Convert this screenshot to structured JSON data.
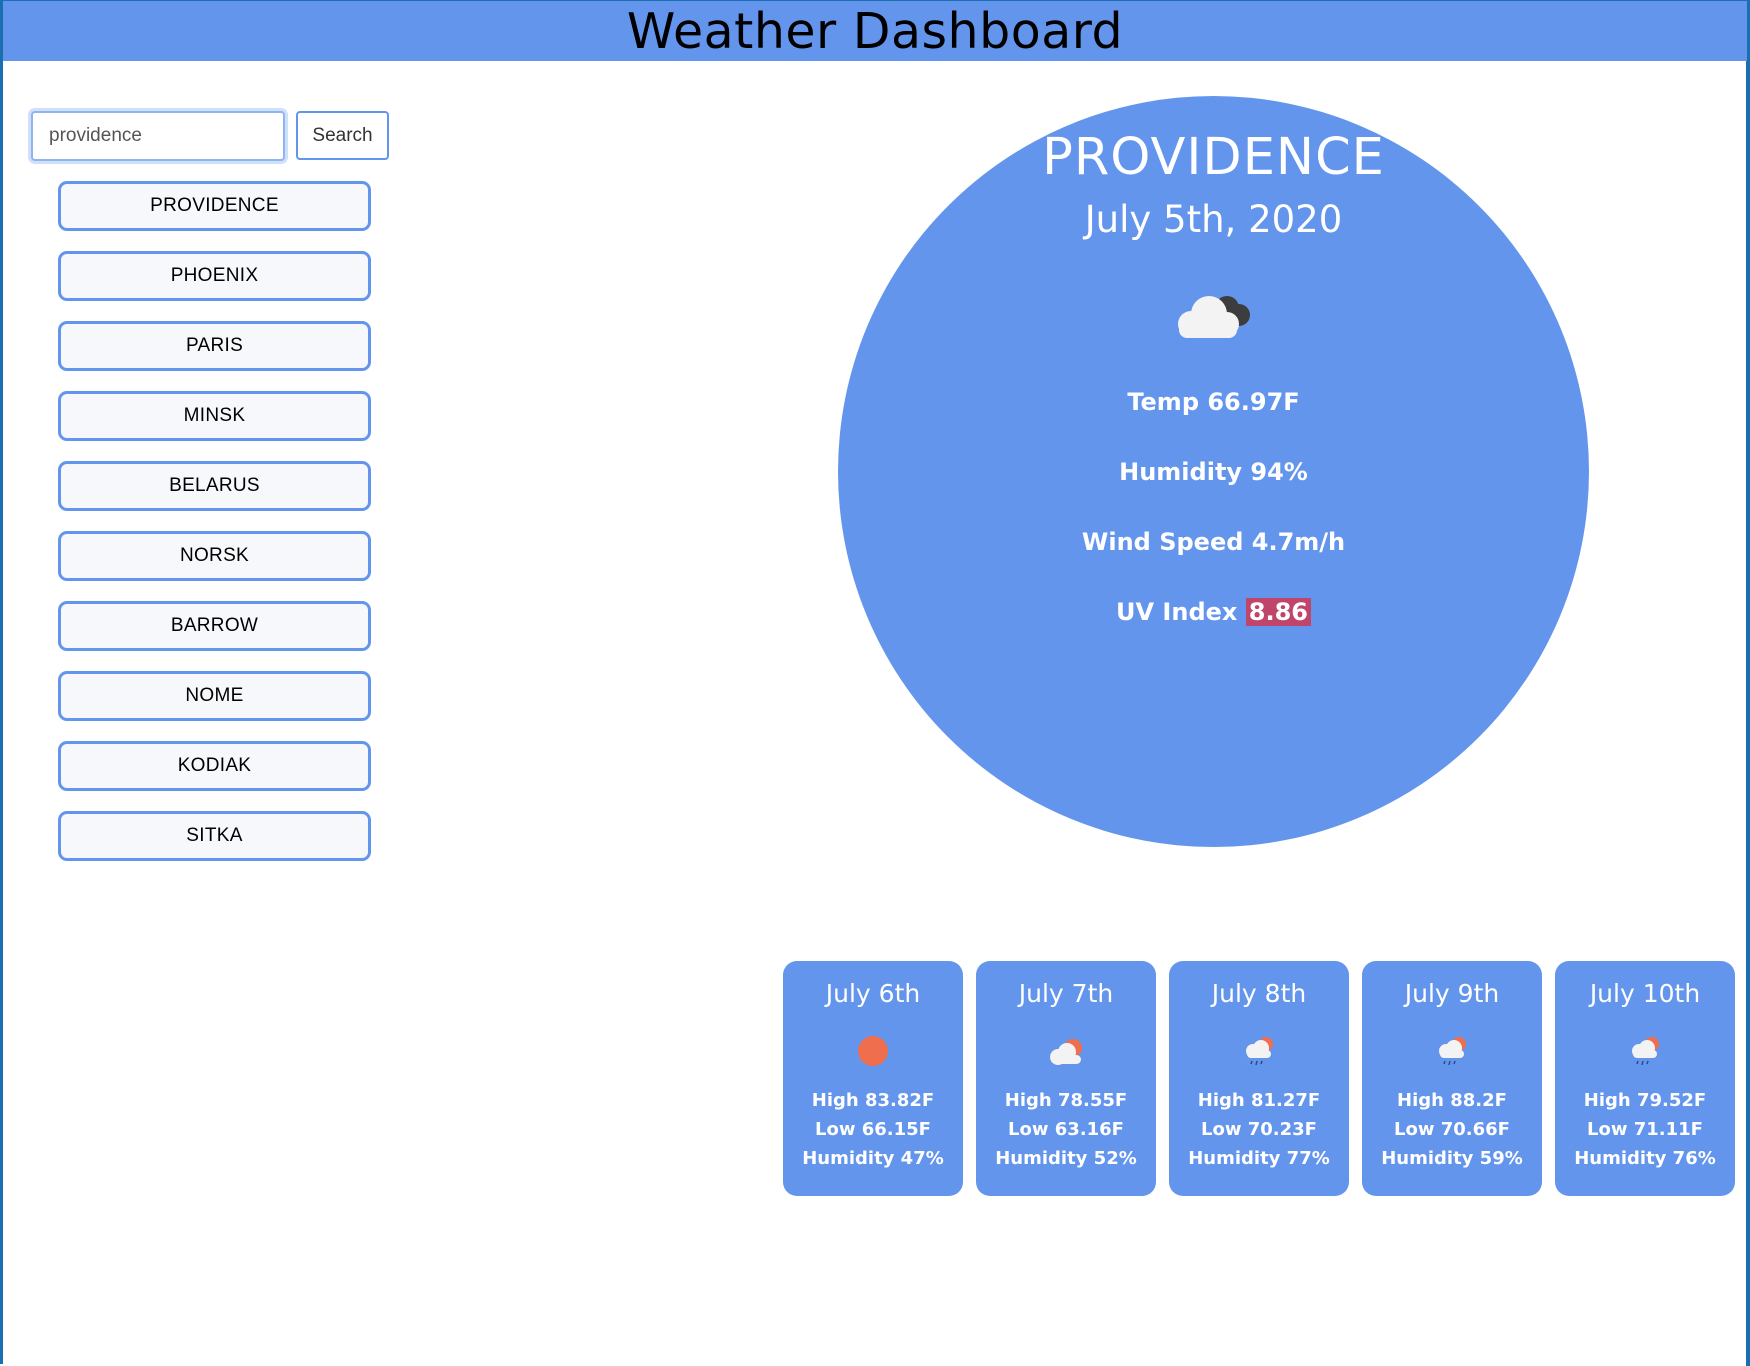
{
  "header": {
    "title": "Weather Dashboard"
  },
  "search": {
    "value": "providence",
    "button_label": "Search"
  },
  "cities": [
    "PROVIDENCE",
    "PHOENIX",
    "PARIS",
    "MINSK",
    "BELARUS",
    "NORSK",
    "BARROW",
    "NOME",
    "KODIAK",
    "SITKA"
  ],
  "current": {
    "city": "PROVIDENCE",
    "date": "July 5th, 2020",
    "icon": "cloudy-icon",
    "temp": "Temp 66.97F",
    "humidity": "Humidity 94%",
    "wind": "Wind Speed 4.7m/h",
    "uv_label": "UV Index",
    "uv_value": "8.86",
    "uv_color": "#c0456a"
  },
  "forecast": [
    {
      "date": "July 6th",
      "icon": "sun-icon",
      "high": "High 83.82F",
      "low": "Low 66.15F",
      "humidity": "Humidity 47%"
    },
    {
      "date": "July 7th",
      "icon": "partly-cloudy-icon",
      "high": "High 78.55F",
      "low": "Low 63.16F",
      "humidity": "Humidity 52%"
    },
    {
      "date": "July 8th",
      "icon": "rain-icon",
      "high": "High 81.27F",
      "low": "Low 70.23F",
      "humidity": "Humidity 77%"
    },
    {
      "date": "July 9th",
      "icon": "rain-icon",
      "high": "High 88.2F",
      "low": "Low 70.66F",
      "humidity": "Humidity 59%"
    },
    {
      "date": "July 10th",
      "icon": "rain-icon",
      "high": "High 79.52F",
      "low": "Low 71.11F",
      "humidity": "Humidity 76%"
    }
  ],
  "colors": {
    "accent": "#6495ed",
    "sun": "#ee6e4d"
  }
}
